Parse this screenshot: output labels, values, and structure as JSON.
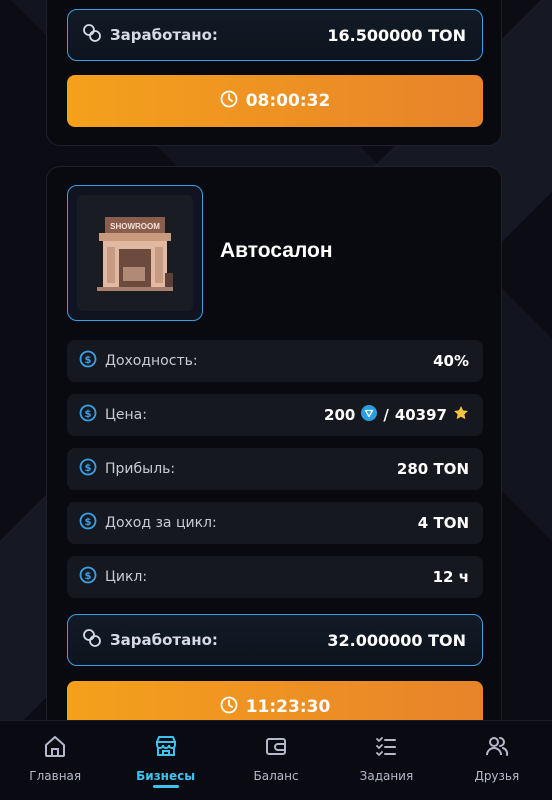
{
  "prev_card": {
    "earned_label": "Заработано:",
    "earned_value": "16.500000 TON",
    "timer": "08:00:32"
  },
  "business": {
    "title": "Автосалон",
    "image_sign": "SHOWROOM",
    "stats": [
      {
        "label": "Доходность:",
        "value": "40%"
      },
      {
        "label": "Цена:",
        "value_ton": "200",
        "separator": "/",
        "value_stars": "40397"
      },
      {
        "label": "Прибыль:",
        "value": "280 TON"
      },
      {
        "label": "Доход за цикл:",
        "value": "4 TON"
      },
      {
        "label": "Цикл:",
        "value": "12 ч"
      }
    ],
    "earned_label": "Заработано:",
    "earned_value": "32.000000 TON",
    "timer": "11:23:30"
  },
  "nav": {
    "items": [
      {
        "label": "Главная",
        "icon": "home-icon"
      },
      {
        "label": "Бизнесы",
        "icon": "store-icon",
        "active": true
      },
      {
        "label": "Баланс",
        "icon": "wallet-icon"
      },
      {
        "label": "Задания",
        "icon": "tasks-icon"
      },
      {
        "label": "Друзья",
        "icon": "users-icon"
      }
    ]
  },
  "colors": {
    "accent_blue": "#3ec3f0",
    "button_orange": "#f4a11c",
    "star": "#f5c542"
  }
}
